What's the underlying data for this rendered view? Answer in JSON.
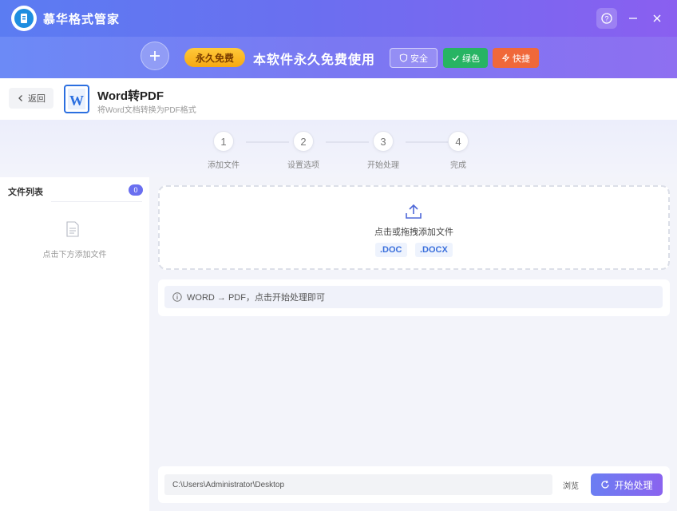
{
  "app": {
    "title": "慕华格式管家"
  },
  "banner": {
    "free_label": "永久免费",
    "text": "本软件永久免费使用",
    "tags": {
      "safe": "安全",
      "green": "绿色",
      "fast": "快捷"
    }
  },
  "header": {
    "back_label": "返回",
    "title": "Word转PDF",
    "subtitle": "将Word文档转换为PDF格式"
  },
  "steps": [
    {
      "number": "1",
      "label": "添加文件"
    },
    {
      "number": "2",
      "label": "设置选项"
    },
    {
      "number": "3",
      "label": "开始处理"
    },
    {
      "number": "4",
      "label": "完成"
    }
  ],
  "sidebar": {
    "title": "文件列表",
    "count": "0",
    "empty_text": "点击下方添加文件"
  },
  "dropzone": {
    "text": "点击或拖拽添加文件",
    "extensions": [
      ".DOC",
      ".DOCX"
    ]
  },
  "info": {
    "text": "WORD → PDF，点击开始处理即可"
  },
  "footer": {
    "output_path": "C:\\Users\\Administrator\\Desktop",
    "browse_label": "浏览",
    "start_label": "开始处理"
  },
  "colors": {
    "accent": "#6a6ff0",
    "green": "#27b463",
    "orange": "#f0683a",
    "gold": "#f7a912"
  }
}
